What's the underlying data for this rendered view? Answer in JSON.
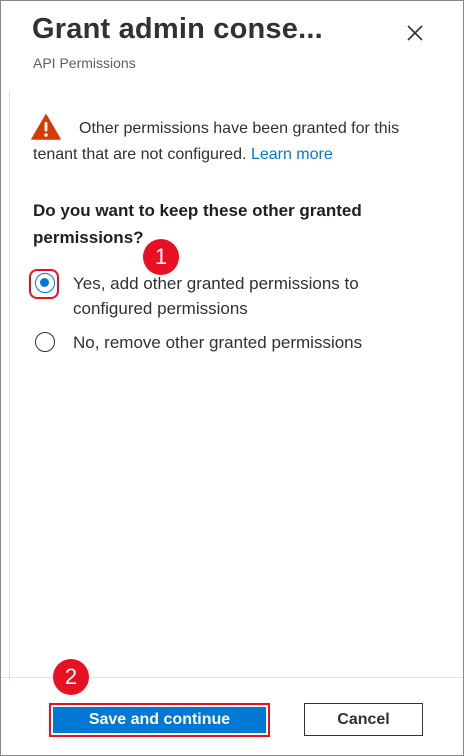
{
  "header": {
    "title": "Grant admin conse...",
    "subtitle": "API Permissions",
    "close_icon": "close-icon"
  },
  "warning": {
    "icon": "warning-icon",
    "icon_color": "#d83b01",
    "text": "Other permissions have been granted for this tenant that are not configured.",
    "link": "Learn more"
  },
  "question": "Do you want to keep these other granted permissions?",
  "options": [
    {
      "label": "Yes, add other granted permissions to configured permissions",
      "selected": true
    },
    {
      "label": "No, remove other granted permissions",
      "selected": false
    }
  ],
  "annotations": {
    "step1": "1",
    "step2": "2",
    "color": "#e81123"
  },
  "footer": {
    "primary_label": "Save and continue",
    "secondary_label": "Cancel",
    "primary_color": "#0078d4"
  }
}
